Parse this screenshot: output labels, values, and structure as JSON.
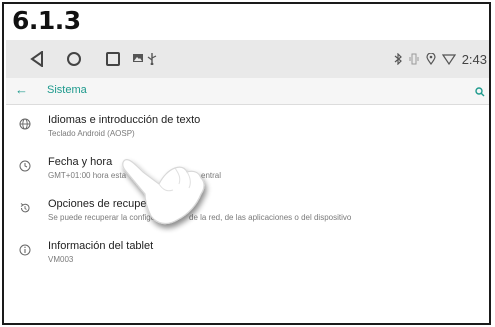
{
  "section_number": "6.1.3",
  "navigation": {
    "back_icon": "triangle-back-icon",
    "home_icon": "circle-home-icon",
    "recents_icon": "square-recents-icon"
  },
  "status_bar": {
    "icons": [
      "image-icon",
      "usb-icon",
      "bluetooth-icon",
      "vibrate-icon",
      "location-icon",
      "wifi-icon"
    ],
    "time": "2:43"
  },
  "app_bar": {
    "title": "Sistema",
    "accent": "#1e9a8d"
  },
  "settings_items": [
    {
      "title": "Idiomas e introducción de texto",
      "subtitle": "Teclado Android (AOSP)",
      "icon": "globe-icon"
    },
    {
      "title": "Fecha y hora",
      "subtitle": "GMT+01:00 hora esta",
      "subtitle_tail": "entral",
      "icon": "clock-icon"
    },
    {
      "title": "Opciones de recupe",
      "subtitle": "Se puede recuperar la configur",
      "subtitle_tail": "de la red, de las aplicaciones o del dispositivo",
      "icon": "restore-icon"
    },
    {
      "title": "Información del tablet",
      "subtitle": "VM003",
      "icon": "info-icon"
    }
  ]
}
